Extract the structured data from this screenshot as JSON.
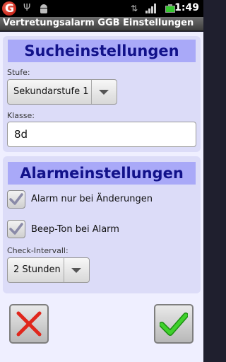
{
  "status_bar": {
    "time": "1:49",
    "icons": [
      "google-g-icon",
      "usb-icon",
      "android-debug-icon",
      "network-icon",
      "signal-icon",
      "battery-icon"
    ]
  },
  "app": {
    "title": "Vertretungsalarm GGB Einstellungen"
  },
  "search_settings": {
    "heading": "Sucheinstellungen",
    "stufe_label": "Stufe:",
    "stufe_value": "Sekundarstufe 1",
    "klasse_label": "Klasse:",
    "klasse_value": "8d"
  },
  "alarm_settings": {
    "heading": "Alarmeinstellungen",
    "checkbox_changes_label": "Alarm nur bei Änderungen",
    "checkbox_changes_checked": true,
    "checkbox_beep_label": "Beep-Ton bei Alarm",
    "checkbox_beep_checked": true,
    "interval_label": "Check-Intervall:",
    "interval_value": "2 Stunden"
  },
  "actions": {
    "cancel_icon": "red-x-icon",
    "confirm_icon": "green-check-icon"
  },
  "colors": {
    "heading_bg": "#a9a9f8",
    "heading_text": "#12128a",
    "panel_bg": "#dcdcf8",
    "content_bg": "#efefff",
    "cancel": "#e0271c",
    "confirm": "#2fb51f"
  }
}
